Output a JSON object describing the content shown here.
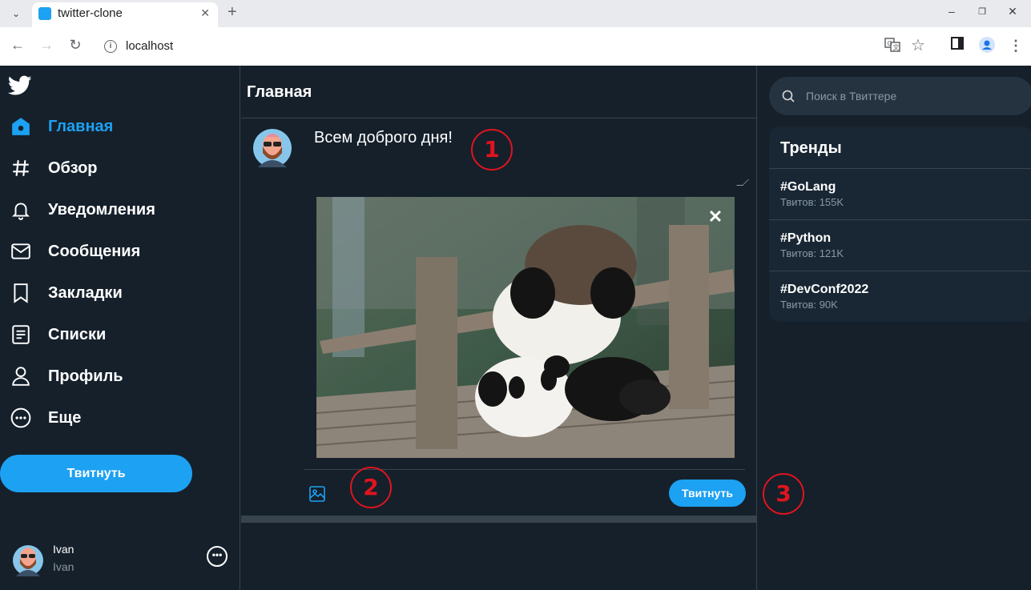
{
  "browser": {
    "tab_title": "twitter-clone",
    "url": "localhost"
  },
  "sidebar": {
    "items": [
      {
        "label": "Главная",
        "icon": "home-icon",
        "active": true
      },
      {
        "label": "Обзор",
        "icon": "hashtag-icon"
      },
      {
        "label": "Уведомления",
        "icon": "bell-icon"
      },
      {
        "label": "Сообщения",
        "icon": "envelope-icon"
      },
      {
        "label": "Закладки",
        "icon": "bookmark-icon"
      },
      {
        "label": "Списки",
        "icon": "list-icon"
      },
      {
        "label": "Профиль",
        "icon": "user-icon"
      },
      {
        "label": "Еще",
        "icon": "more-icon"
      }
    ],
    "tweet_button": "Твитнуть",
    "user": {
      "name": "Ivan",
      "handle": "Ivan"
    }
  },
  "main": {
    "title": "Главная",
    "compose": {
      "text": "Всем доброго дня!",
      "submit_label": "Твитнуть",
      "attachment": "panda-photo"
    }
  },
  "right": {
    "search_placeholder": "Поиск в Твиттере",
    "trends_title": "Тренды",
    "trends": [
      {
        "tag": "#GoLang",
        "count": "Твитов: 155K"
      },
      {
        "tag": "#Python",
        "count": "Твитов: 121K"
      },
      {
        "tag": "#DevConf2022",
        "count": "Твитов: 90K"
      }
    ]
  },
  "annotations": [
    "1",
    "2",
    "3"
  ],
  "colors": {
    "accent": "#1da1f2",
    "background": "#15202b",
    "annotation": "#e0141e"
  }
}
